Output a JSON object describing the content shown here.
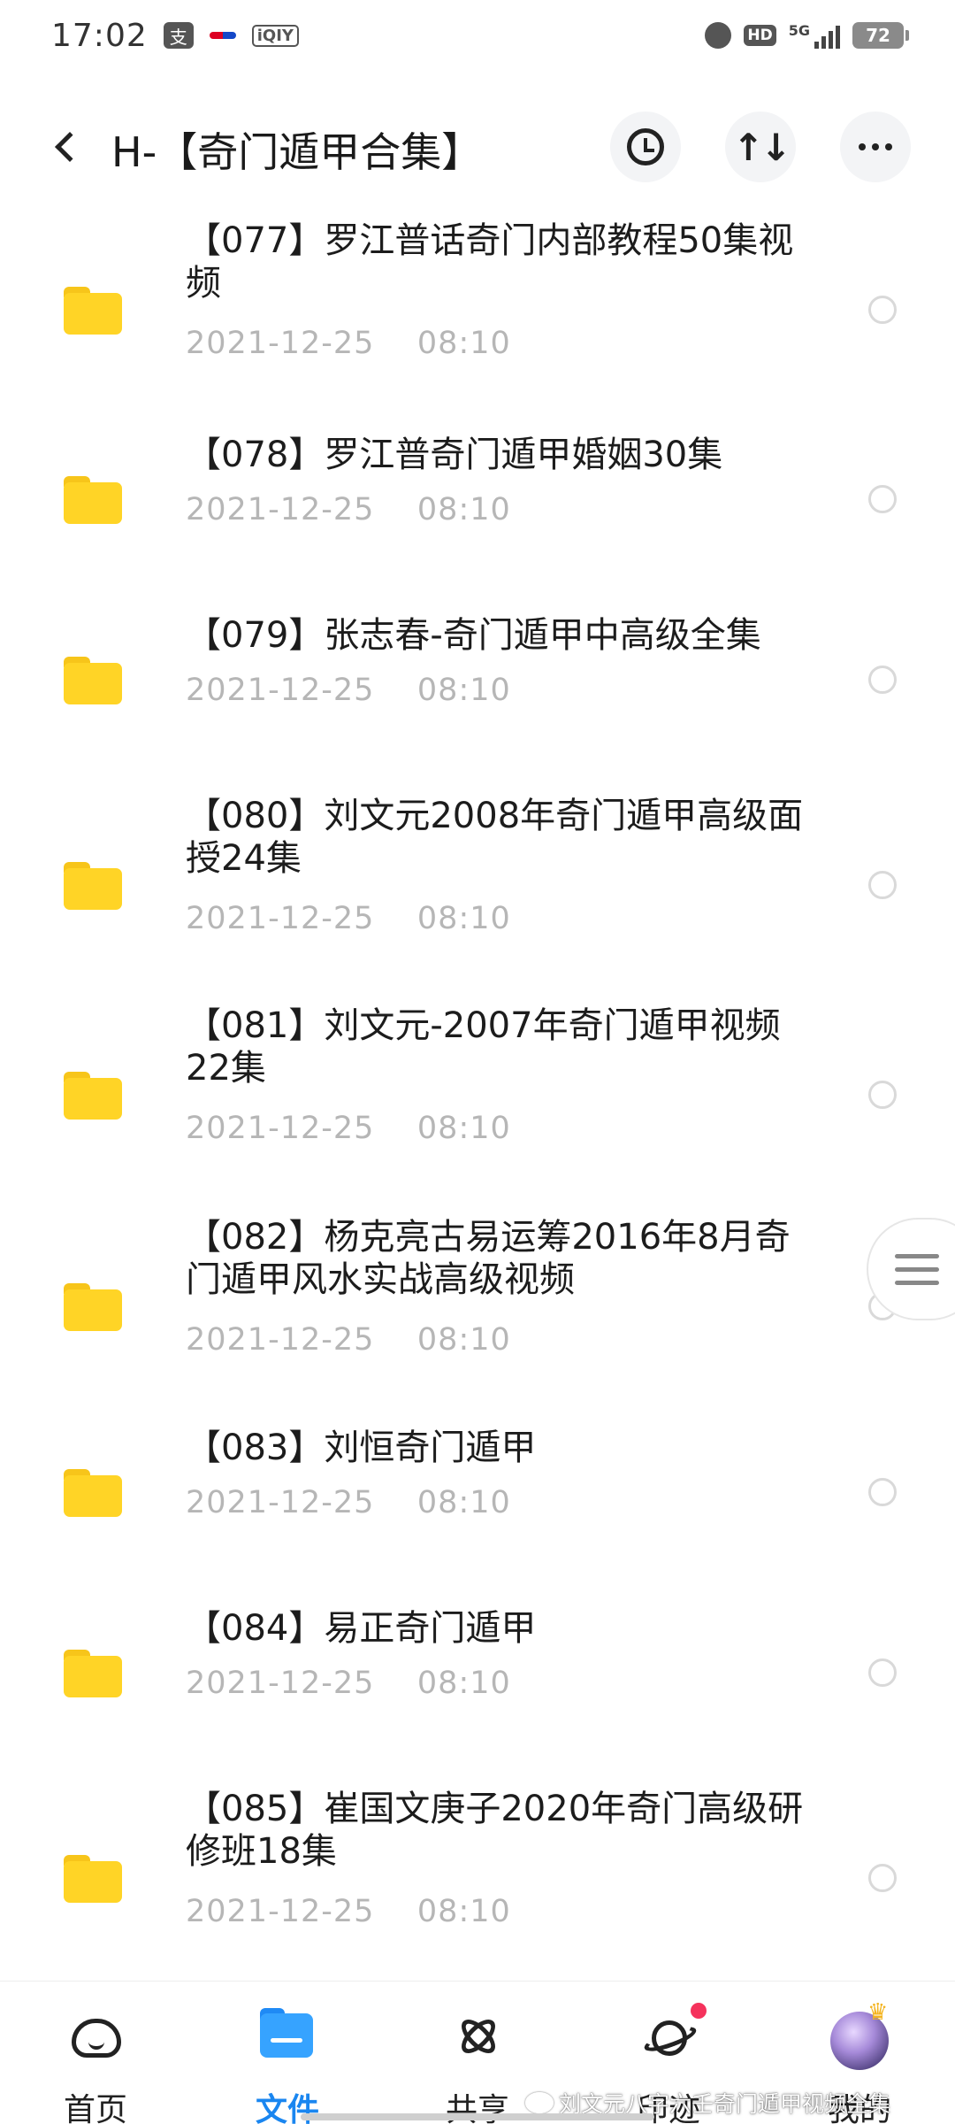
{
  "status_bar": {
    "time": "17:02",
    "app_icons": [
      "alipay-icon",
      "airline-icon",
      "iqiyi-icon"
    ],
    "alipay_glyph": "支",
    "iqiyi_label": "iQIY",
    "hd_label": "HD",
    "network_label": "5G",
    "battery": "72"
  },
  "header": {
    "title": "H-【奇门遁甲合集】",
    "buttons": [
      "history-icon",
      "sort-icon",
      "more-icon"
    ],
    "sort_glyph": "↑↓"
  },
  "files": [
    {
      "name": "【077】罗江普话奇门内部教程50集视频",
      "date": "2021-12-25    08:10"
    },
    {
      "name": "【078】罗江普奇门遁甲婚姻30集",
      "date": "2021-12-25    08:10"
    },
    {
      "name": "【079】张志春-奇门遁甲中高级全集",
      "date": "2021-12-25    08:10"
    },
    {
      "name": "【080】刘文元2008年奇门遁甲高级面授24集",
      "date": "2021-12-25    08:10"
    },
    {
      "name": "【081】刘文元-2007年奇门遁甲视频22集",
      "date": "2021-12-25    08:10"
    },
    {
      "name": "【082】杨克亮古易运筹2016年8月奇门遁甲风水实战高级视频",
      "date": "2021-12-25    08:10"
    },
    {
      "name": "【083】刘恒奇门遁甲",
      "date": "2021-12-25    08:10"
    },
    {
      "name": "【084】易正奇门遁甲",
      "date": "2021-12-25    08:10"
    },
    {
      "name": "【085】崔国文庚子2020年奇门高级研修班18集",
      "date": "2021-12-25    08:10"
    }
  ],
  "tab_bar": {
    "tabs": [
      {
        "label": "首页",
        "icon": "home-cloud-icon"
      },
      {
        "label": "文件",
        "icon": "folder-icon",
        "active": true
      },
      {
        "label": "共享",
        "icon": "atom-icon"
      },
      {
        "label": "印迹",
        "icon": "planet-icon",
        "badge": "dot"
      },
      {
        "label": "我的",
        "icon": "avatar"
      }
    ],
    "active_color": "#1a86f0"
  },
  "watermark": "刘文元八字六壬奇门遁甲视频全集",
  "colors": {
    "folder": "#ffd426",
    "date_text": "#b6b6b6",
    "badge": "#f5325c"
  }
}
